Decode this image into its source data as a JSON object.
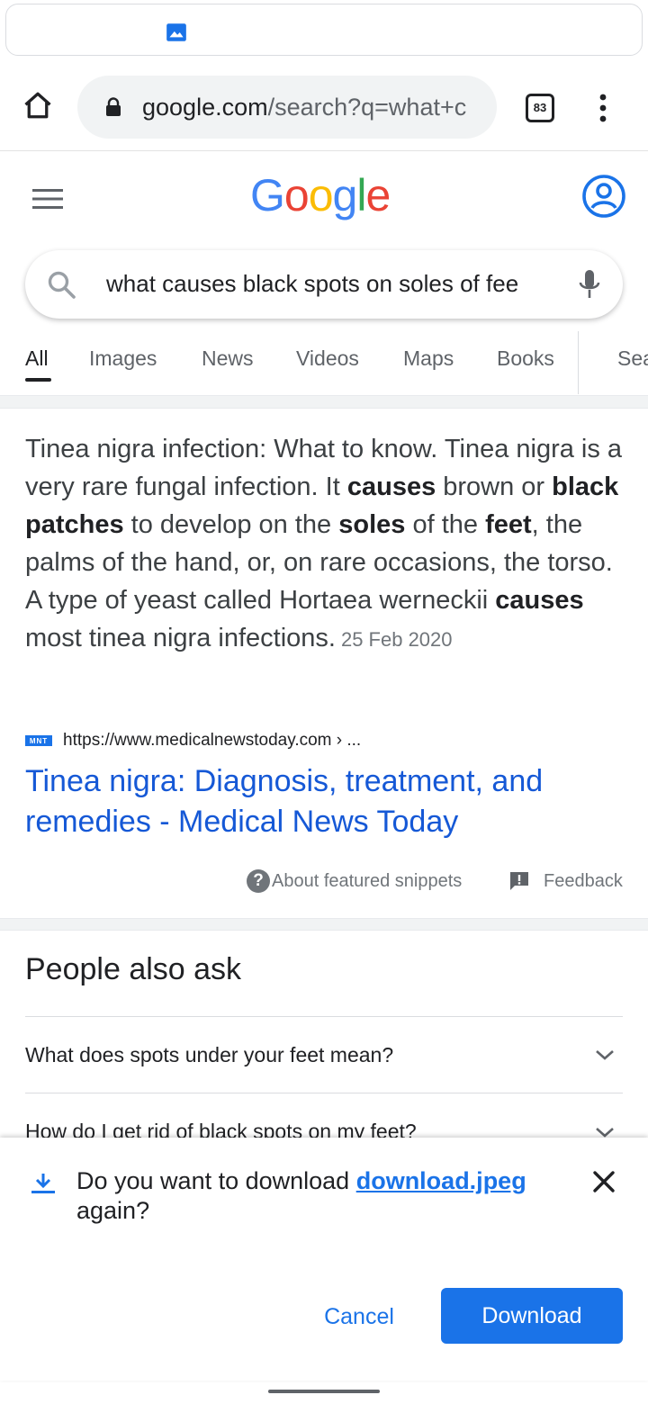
{
  "browser": {
    "url_host": "google.com",
    "url_path": "/search?q=what+c",
    "tab_count": "83"
  },
  "google": {
    "logo": [
      "G",
      "o",
      "o",
      "g",
      "l",
      "e"
    ],
    "query": "what causes black spots on soles of fee"
  },
  "tabs": [
    "All",
    "Images",
    "News",
    "Videos",
    "Maps",
    "Books",
    "Search tools"
  ],
  "snippet": {
    "segments": [
      {
        "t": "Tinea nigra infection: What to know. Tinea nigra is a very rare fungal infection. It ",
        "b": false
      },
      {
        "t": "causes",
        "b": true
      },
      {
        "t": " brown or ",
        "b": false
      },
      {
        "t": "black patches",
        "b": true
      },
      {
        "t": " to develop on the ",
        "b": false
      },
      {
        "t": "soles",
        "b": true
      },
      {
        "t": " of the ",
        "b": false
      },
      {
        "t": "feet",
        "b": true
      },
      {
        "t": ", the palms of the hand, or, on rare occasions, the torso. A type of yeast called Hortaea werneckii ",
        "b": false
      },
      {
        "t": "causes",
        "b": true
      },
      {
        "t": " most tinea nigra infections.",
        "b": false
      }
    ],
    "date": "25 Feb 2020",
    "favicon_text": "MNT",
    "source_url": "https://www.medicalnewstoday.com › ...",
    "title": "Tinea nigra: Diagnosis, treatment, and remedies - Medical News Today",
    "about_label": "About featured snippets",
    "feedback_label": "Feedback"
  },
  "paa": {
    "title": "People also ask",
    "questions": [
      "What does spots under your feet mean?",
      "How do I get rid of black spots on my feet?"
    ]
  },
  "download": {
    "prefix": "Do you want to download ",
    "filename": "download.jpeg",
    "suffix": "again?",
    "cancel_label": "Cancel",
    "download_label": "Download"
  },
  "colors": {
    "accent": "#1a73e8",
    "link": "#1558d6",
    "logo": [
      "#4285f4",
      "#ea4335",
      "#fbbc05",
      "#4285f4",
      "#34a853",
      "#ea4335"
    ]
  }
}
